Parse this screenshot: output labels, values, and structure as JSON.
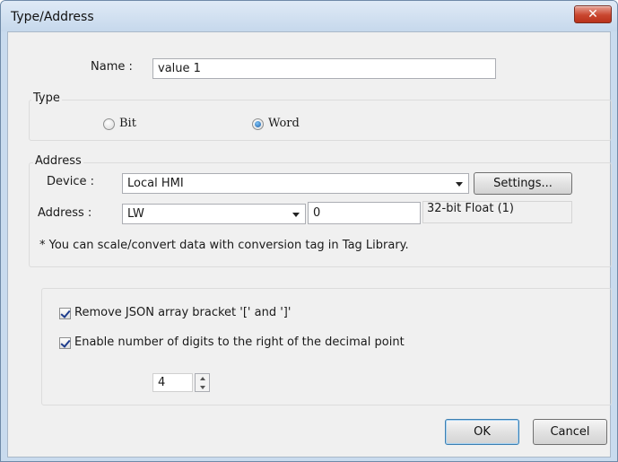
{
  "window": {
    "title": "Type/Address"
  },
  "name_row": {
    "label": "Name :",
    "value": "value 1"
  },
  "type_group": {
    "title": "Type",
    "options": [
      {
        "label": "Bit",
        "selected": false
      },
      {
        "label": "Word",
        "selected": true
      }
    ]
  },
  "address_group": {
    "title": "Address",
    "device_label": "Device :",
    "device_value": "Local HMI",
    "settings_label": "Settings...",
    "address_label": "Address :",
    "address_type": "LW",
    "address_value": "0",
    "data_format": "32-bit Float (1)",
    "note": "* You can scale/convert data with conversion tag in Tag Library."
  },
  "options_group": {
    "remove_bracket_label": "Remove JSON array bracket '[' and ']'",
    "remove_bracket_checked": true,
    "decimal_label": "Enable number of digits to the right of the decimal point",
    "decimal_checked": true,
    "decimal_digits": "4"
  },
  "footer": {
    "ok_label": "OK",
    "cancel_label": "Cancel"
  },
  "colors": {
    "accent": "#3c7fb1",
    "close": "#c9462f"
  }
}
